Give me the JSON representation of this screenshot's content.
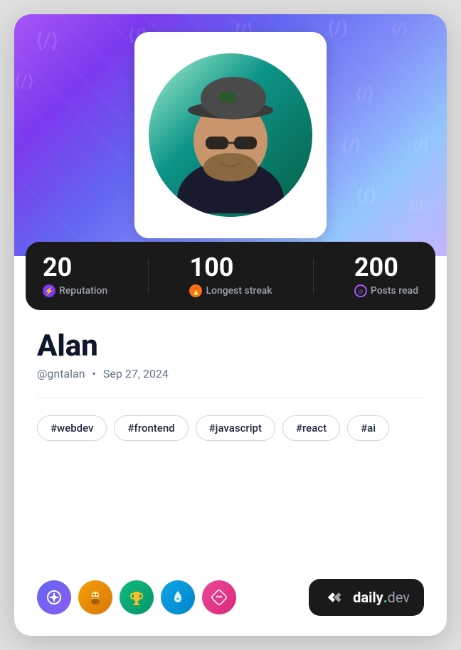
{
  "card": {
    "header": {
      "alt": "Profile header background"
    },
    "stats": {
      "reputation": {
        "value": "20",
        "label": "Reputation",
        "icon": "⚡"
      },
      "streak": {
        "value": "100",
        "label": "Longest streak",
        "icon": "🔥"
      },
      "posts": {
        "value": "200",
        "label": "Posts read",
        "icon": "○"
      }
    },
    "user": {
      "name": "Alan",
      "handle": "@gntalan",
      "separator": "•",
      "join_date": "Sep 27, 2024"
    },
    "tags": [
      "#webdev",
      "#frontend",
      "#javascript",
      "#react",
      "#ai"
    ],
    "badges": [
      {
        "id": 1,
        "emoji": "🎯",
        "label": "badge-target"
      },
      {
        "id": 2,
        "emoji": "🧑",
        "label": "badge-person"
      },
      {
        "id": 3,
        "emoji": "🏆",
        "label": "badge-trophy"
      },
      {
        "id": 4,
        "emoji": "💧",
        "label": "badge-drop"
      },
      {
        "id": 5,
        "emoji": "◈",
        "label": "badge-diamond"
      }
    ],
    "branding": {
      "daily": "daily",
      "dot": ".",
      "dev": "dev"
    }
  }
}
